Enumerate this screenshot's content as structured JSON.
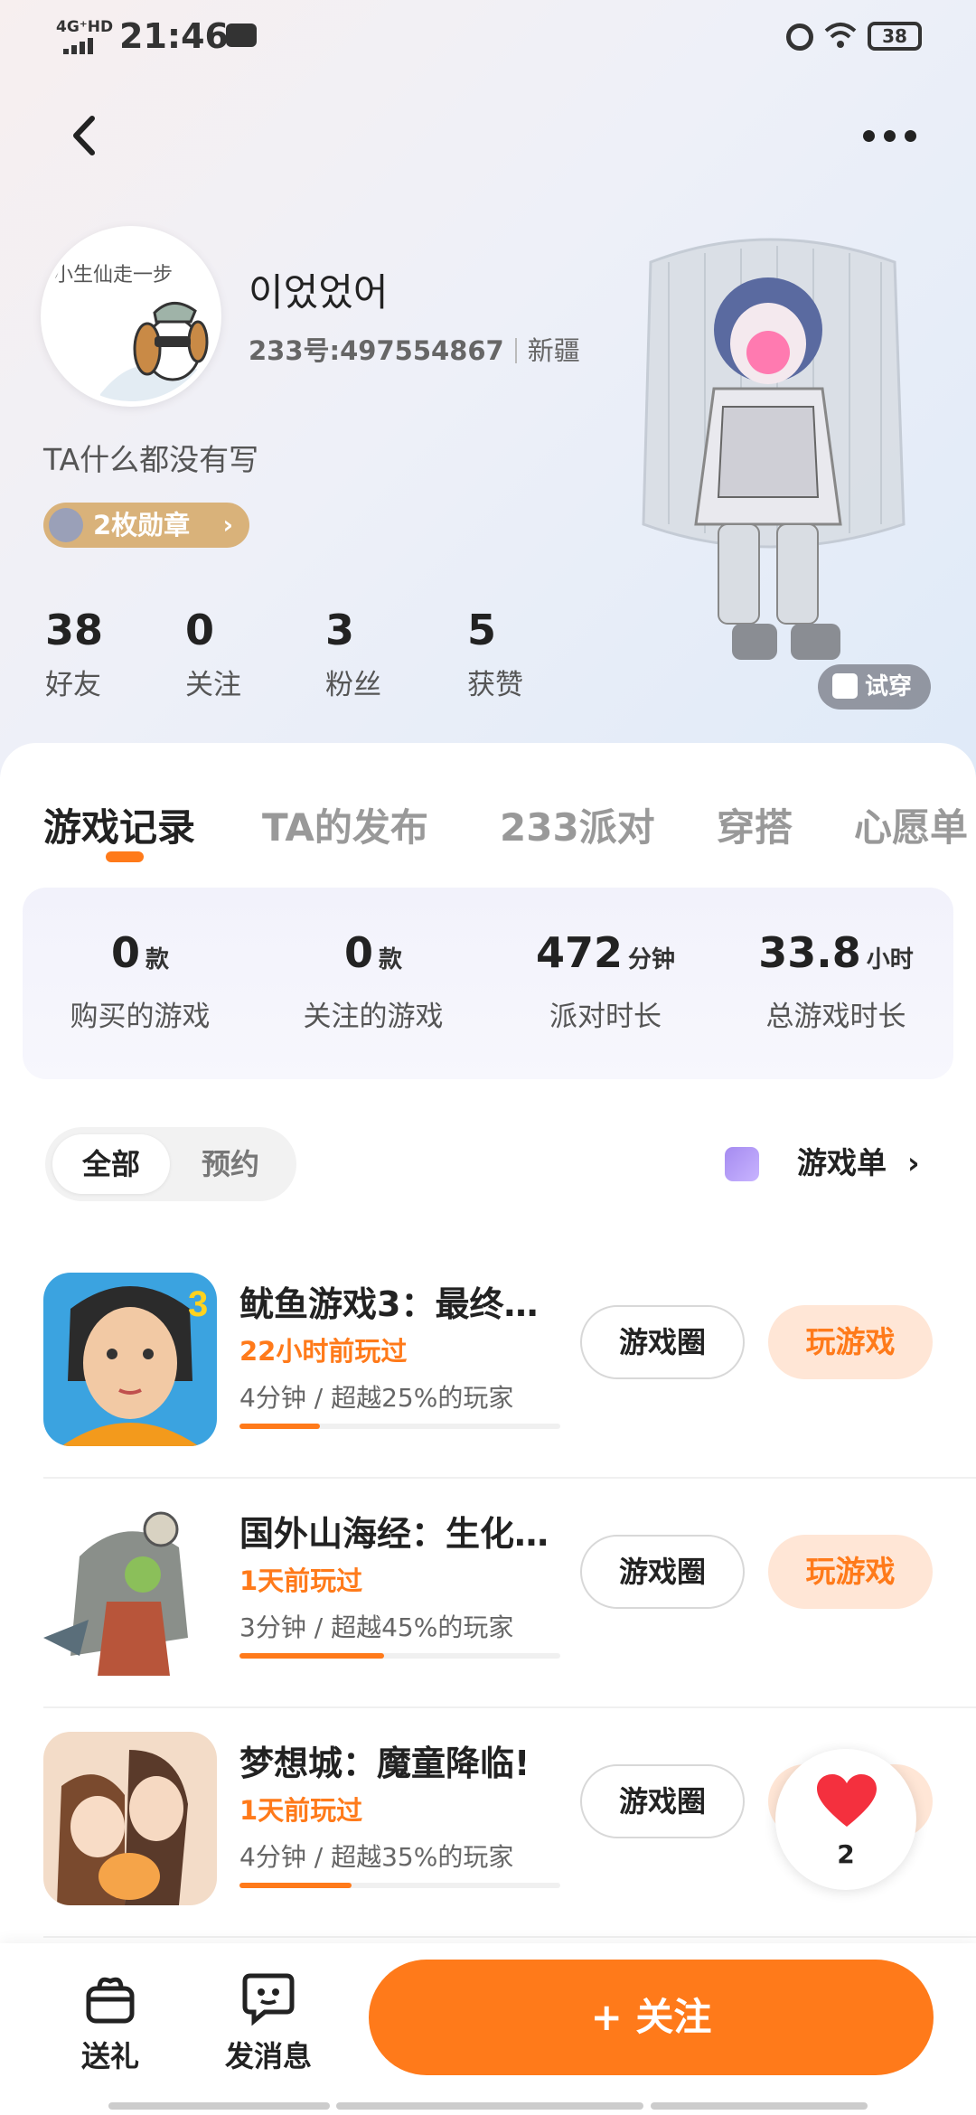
{
  "status_bar": {
    "network": "4G⁺HD",
    "time": "21:46",
    "battery": "38"
  },
  "profile": {
    "avatar_text": "小生仙走一步",
    "name": "이었었어",
    "uid": "233号:497554867",
    "location": "新疆",
    "bio": "TA什么都没有写",
    "badge": "2枚勋章"
  },
  "stats": [
    {
      "value": "38",
      "label": "好友"
    },
    {
      "value": "0",
      "label": "关注"
    },
    {
      "value": "3",
      "label": "粉丝"
    },
    {
      "value": "5",
      "label": "获赞"
    }
  ],
  "try_on": "试穿",
  "tabs": [
    "游戏记录",
    "TA的发布",
    "233派对",
    "穿搭",
    "心愿单"
  ],
  "active_tab": "游戏记录",
  "summary": [
    {
      "value": "0",
      "unit": "款",
      "label": "购买的游戏"
    },
    {
      "value": "0",
      "unit": "款",
      "label": "关注的游戏"
    },
    {
      "value": "472",
      "unit": "分钟",
      "label": "派对时长"
    },
    {
      "value": "33.8",
      "unit": "小时",
      "label": "总游戏时长"
    }
  ],
  "filters": {
    "all": "全部",
    "reserve": "预约",
    "selected": "全部"
  },
  "game_list_link": "游戏单",
  "games": [
    {
      "name": "鱿鱼游戏3：最终…",
      "played": "22小时前玩过",
      "duration": "4分钟",
      "beat": "超越25%的玩家",
      "progress": 0.25,
      "circle": "游戏圈",
      "play": "玩游戏"
    },
    {
      "name": "国外山海经：生化…",
      "played": "1天前玩过",
      "duration": "3分钟",
      "beat": "超越45%的玩家",
      "progress": 0.45,
      "circle": "游戏圈",
      "play": "玩游戏"
    },
    {
      "name": "梦想城：魔童降临!",
      "played": "1天前玩过",
      "duration": "4分钟",
      "beat": "超越35%的玩家",
      "progress": 0.35,
      "circle": "游戏圈",
      "play": "玩游戏"
    }
  ],
  "meta_separator": "/",
  "like_count": "2",
  "bottom": {
    "gift": "送礼",
    "message": "发消息",
    "follow": "+ 关注"
  },
  "colors": {
    "accent": "#ff7a1a",
    "accent_light": "#ffe6d6"
  }
}
